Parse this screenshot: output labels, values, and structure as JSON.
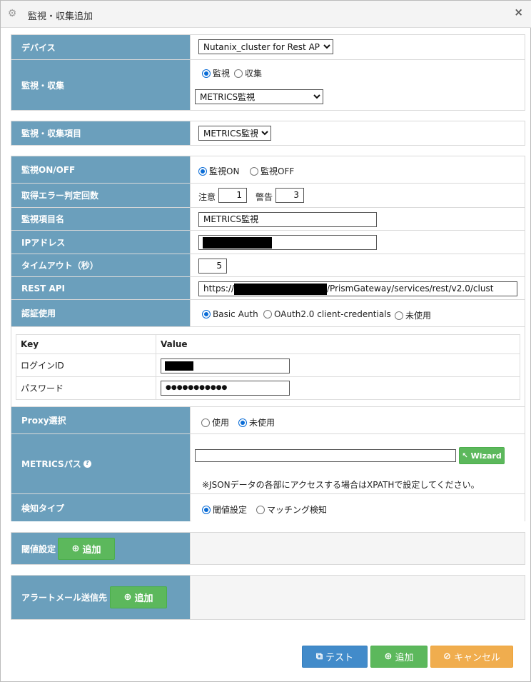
{
  "window": {
    "title": "監視・収集追加",
    "close": "×",
    "icon": "gear-icon"
  },
  "device": {
    "label": "デバイス",
    "selected": "Nutanix_cluster for Rest API"
  },
  "monitor_collect": {
    "label": "監視・収集",
    "option_monitor": "監視",
    "option_collect": "収集",
    "selected_option": "監視",
    "type_selected": "METRICS監視"
  },
  "item": {
    "label": "監視・収集項目",
    "selected": "METRICS監視"
  },
  "onoff": {
    "label": "監視ON/OFF",
    "on": "監視ON",
    "off": "監視OFF",
    "selected": "監視ON"
  },
  "error_count": {
    "label": "取得エラー判定回数",
    "caution_label": "注意",
    "caution_value": "1",
    "warning_label": "警告",
    "warning_value": "3"
  },
  "item_name": {
    "label": "監視項目名",
    "value": "METRICS監視"
  },
  "ip": {
    "label": "IPアドレス"
  },
  "timeout": {
    "label": "タイムアウト（秒）",
    "value": "5"
  },
  "rest_api": {
    "label": "REST API",
    "prefix": "https://",
    "suffix": "/PrismGateway/services/rest/v2.0/clust"
  },
  "auth": {
    "label": "認証使用",
    "basic": "Basic Auth",
    "oauth": "OAuth2.0 client-credentials",
    "none": "未使用",
    "selected": "Basic Auth"
  },
  "credentials": {
    "col_key": "Key",
    "col_value": "Value",
    "login_label": "ログインID",
    "password_label": "パスワード",
    "password_value": "●●●●●●●●●●●"
  },
  "proxy": {
    "label": "Proxy選択",
    "use": "使用",
    "no_use": "未使用",
    "selected": "未使用"
  },
  "metrics_path": {
    "label": "METRICSパス",
    "help_icon": "question-circle-icon",
    "wizard": "Wizard",
    "note": "※JSONデータの各部にアクセスする場合はXPATHで設定してください。"
  },
  "detect_type": {
    "label": "検知タイプ",
    "threshold": "閾値設定",
    "matching": "マッチング検知",
    "selected": "閾値設定"
  },
  "threshold": {
    "label": "閾値設定",
    "add": "追加"
  },
  "alert_mail": {
    "label": "アラートメール送信先",
    "add": "追加"
  },
  "footer": {
    "test": "テスト",
    "add": "追加",
    "cancel": "キャンセル"
  },
  "colors": {
    "label_bg": "#6b9fbc",
    "green": "#5cb85c",
    "blue": "#428bca",
    "orange": "#f0ad4e"
  }
}
